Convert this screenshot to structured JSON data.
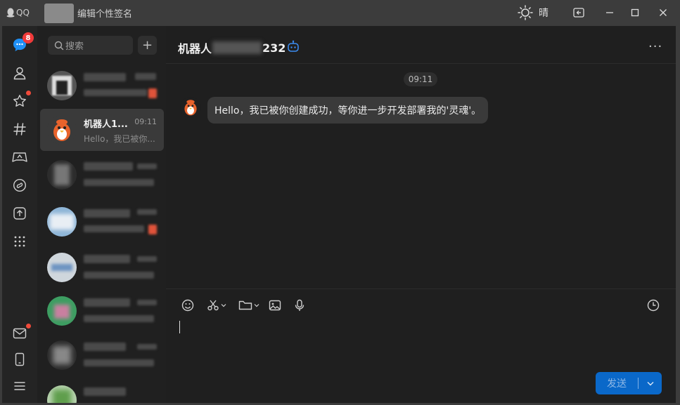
{
  "titlebar": {
    "app_name": "QQ",
    "signature": "编辑个性签名",
    "weather": "晴"
  },
  "rail": {
    "unread_badge": "8"
  },
  "search": {
    "placeholder": "搜索",
    "add_label": "+"
  },
  "conversations": [
    {
      "name": "",
      "time": "",
      "preview": "",
      "blurred": true
    },
    {
      "name": "机器人1...",
      "time": "09:11",
      "preview": "Hello，我已被你...",
      "blurred": false,
      "active": true
    },
    {
      "name": "",
      "time": "",
      "preview": "",
      "blurred": true
    },
    {
      "name": "",
      "time": "",
      "preview": "",
      "blurred": true
    },
    {
      "name": "",
      "time": "",
      "preview": "",
      "blurred": true
    },
    {
      "name": "",
      "time": "",
      "preview": "",
      "blurred": true
    },
    {
      "name": "",
      "time": "",
      "preview": "",
      "blurred": true
    }
  ],
  "chat": {
    "title_prefix": "机器人",
    "title_suffix": "232",
    "more_label": "···",
    "timestamp": "09:11",
    "message": "Hello，我已被你创建成功，等你进一步开发部署我的'灵魂'。"
  },
  "composer": {
    "send_label": "发送"
  },
  "colors": {
    "accent": "#0a68c9",
    "badge": "#f03a3a",
    "background": "#1f1f1f"
  }
}
